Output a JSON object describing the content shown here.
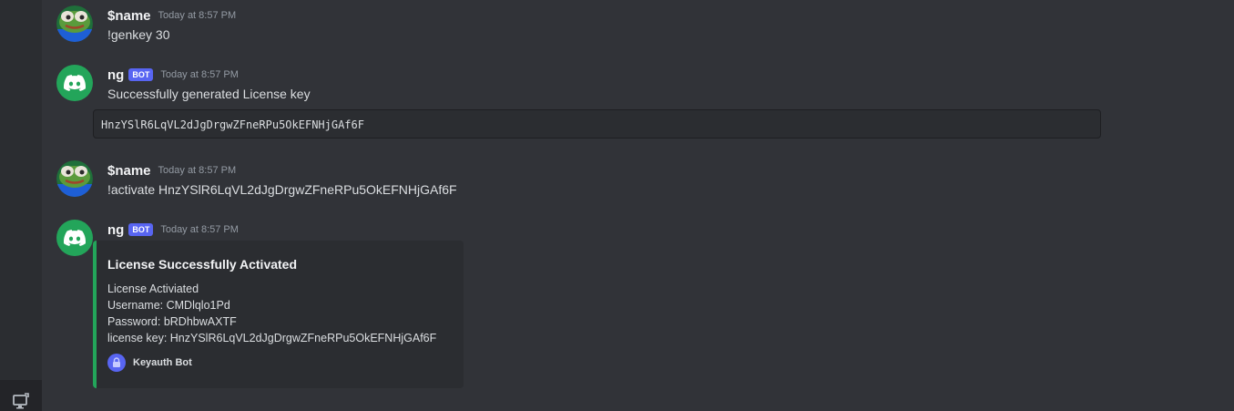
{
  "messages": [
    {
      "author": "$name",
      "timestamp": "Today at 8:57 PM",
      "text": "!genkey 30",
      "avatar_icon": "frog-avatar-icon"
    },
    {
      "author": "ng",
      "tag": "BOT",
      "timestamp": "Today at 8:57 PM",
      "text": "Successfully generated License key",
      "code": "HnzYSlR6LqVL2dJgDrgwZFneRPu5OkEFNHjGAf6F",
      "avatar_icon": "discord-icon"
    },
    {
      "author": "$name",
      "timestamp": "Today at 8:57 PM",
      "text": "!activate HnzYSlR6LqVL2dJgDrgwZFneRPu5OkEFNHjGAf6F",
      "avatar_icon": "frog-avatar-icon"
    },
    {
      "author": "ng",
      "tag": "BOT",
      "timestamp": "Today at 8:57 PM",
      "avatar_icon": "discord-icon",
      "embed": {
        "title": "License Successfully Activated",
        "lines": [
          "License Activiated",
          "Username: CMDlqlo1Pd",
          "Password: bRDhbwAXTF",
          "license key: HnzYSlR6LqVL2dJgDrgwZFneRPu5OkEFNHjGAf6F"
        ],
        "footer": "Keyauth Bot",
        "footer_icon": "lock-icon",
        "accent_color": "#23a55a"
      }
    }
  ],
  "colors": {
    "background": "#313338",
    "bot_tag": "#5865f2",
    "bot_avatar": "#23a55a"
  },
  "rail": {
    "bottom_icon": "monitor-icon"
  }
}
